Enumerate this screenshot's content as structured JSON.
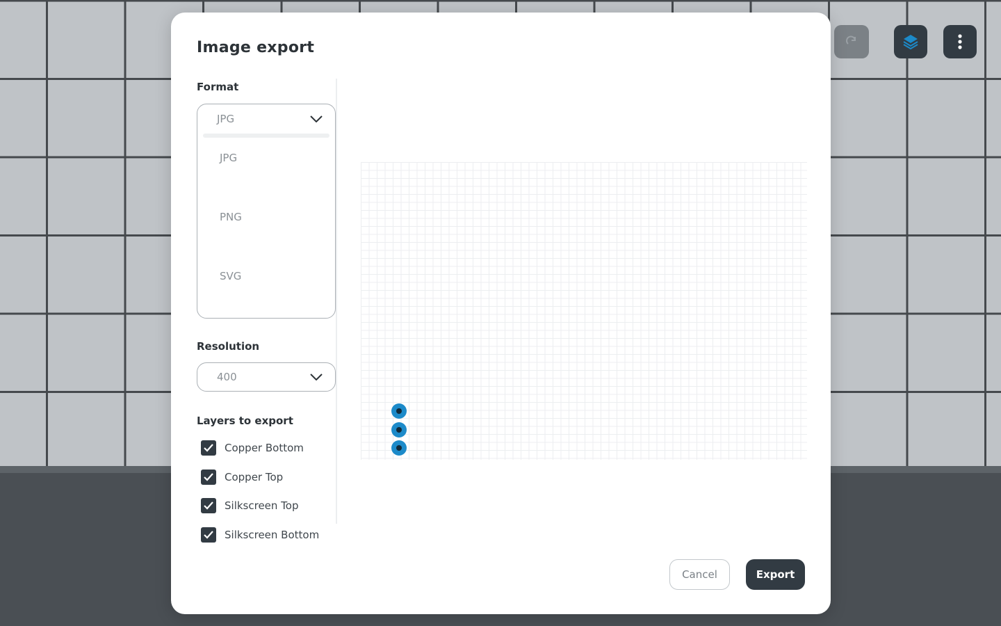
{
  "toolbar": {
    "redo_icon": "redo-icon",
    "layers_icon": "layers-icon",
    "more_icon": "more-vertical-icon"
  },
  "modal": {
    "title": "Image export",
    "format": {
      "label": "Format",
      "selected": "JPG",
      "options": [
        "JPG",
        "PNG",
        "SVG"
      ],
      "expanded": true
    },
    "resolution": {
      "label": "Resolution",
      "selected": "400"
    },
    "layers": {
      "label": "Layers to export",
      "items": [
        {
          "label": "Copper Bottom",
          "checked": true
        },
        {
          "label": "Copper Top",
          "checked": true
        },
        {
          "label": "Silkscreen Top",
          "checked": true
        },
        {
          "label": "Silkscreen Bottom",
          "checked": true
        }
      ]
    },
    "buttons": {
      "cancel": "Cancel",
      "export": "Export"
    }
  },
  "colors": {
    "primary": "#323b43",
    "pad": "#1c8ac9",
    "workspace": "#bfc3c7"
  }
}
